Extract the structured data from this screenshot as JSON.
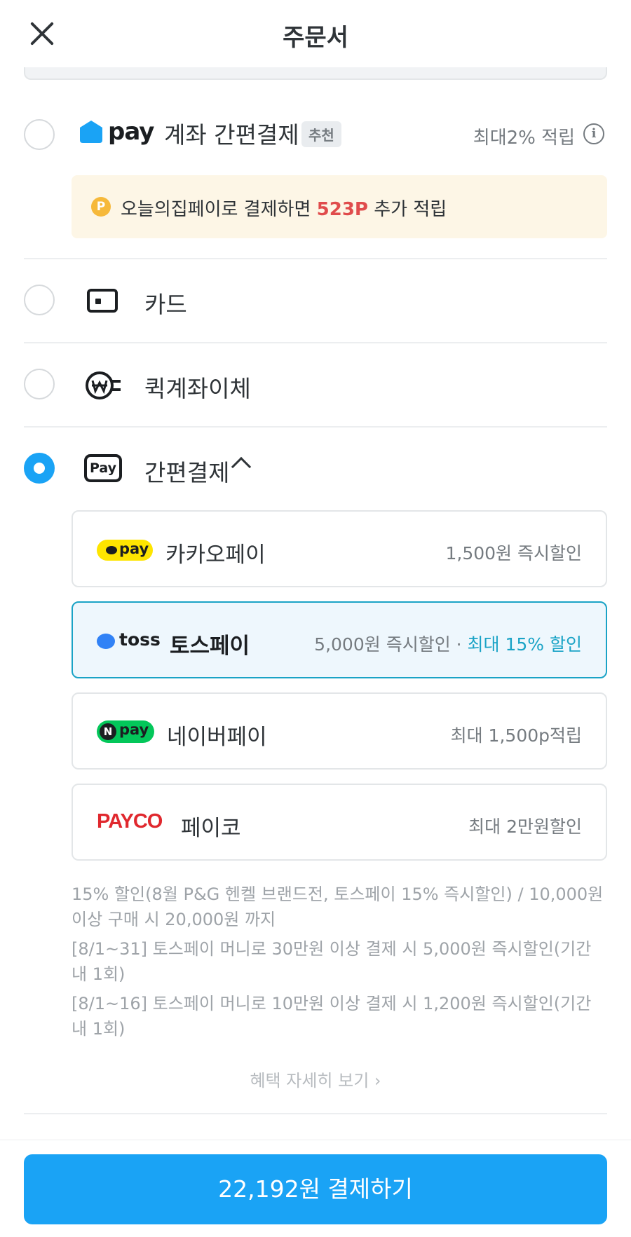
{
  "header": {
    "title": "주문서"
  },
  "ohouse_pay": {
    "logo_text": "pay",
    "label": "계좌 간편결제",
    "badge": "추천",
    "benefit": "최대2% 적립",
    "info_glyph": "i",
    "point_icon": "P",
    "point_prefix": "오늘의집페이로 결제하면 ",
    "point_amount": "523P",
    "point_suffix": " 추가 적립"
  },
  "methods": {
    "card": "카드",
    "quick_transfer": "퀵계좌이체",
    "easy_pay": "간편결제",
    "pay_icon_text": "Pay"
  },
  "pay_options": {
    "kakao": {
      "logo": "pay",
      "name": "카카오페이",
      "benefit": "1,500원 즉시할인"
    },
    "toss": {
      "logo": "toss",
      "name": "토스페이",
      "benefit": "5,000원 즉시할인 · ",
      "benefit_highlight": "최대 15% 할인"
    },
    "naver": {
      "logo_n": "N",
      "logo": "pay",
      "name": "네이버페이",
      "benefit": "최대 1,500p적립"
    },
    "payco": {
      "logo": "PAYCO",
      "name": "페이코",
      "benefit": "최대 2만원할인"
    }
  },
  "notes": [
    "15% 할인(8월 P&G 헨켈 브랜드전, 토스페이 15% 즉시할인) / 10,000원 이상 구매 시 20,000원 까지",
    "[8/1~31] 토스페이 머니로 30만원 이상 결제 시 5,000원 즉시할인(기간 내 1회)",
    "[8/1~16] 토스페이 머니로 10만원 이상 결제 시 1,200원 즉시할인(기간 내 1회)"
  ],
  "more_link": "혜택 자세히 보기 ›",
  "pay_button": "22,192원 결제하기",
  "colors": {
    "primary": "#1aa3f5",
    "accent_red": "#e04c4c",
    "toss_blue": "#1aa3c6"
  }
}
